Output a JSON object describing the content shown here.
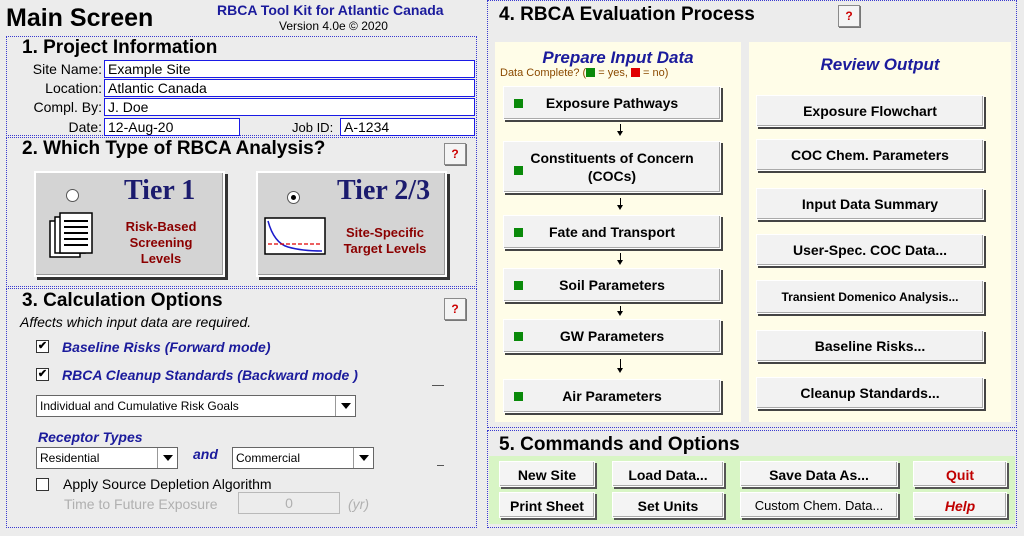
{
  "header": {
    "main_title": "Main Screen",
    "toolkit_title": "RBCA Tool Kit for Atlantic Canada",
    "version": "Version 4.0e  © 2020"
  },
  "project": {
    "title": "1.  Project Information",
    "site_name_label": "Site Name:",
    "site_name": "Example Site",
    "location_label": "Location:",
    "location": "Atlantic Canada",
    "compl_by_label": "Compl. By:",
    "compl_by": "J. Doe",
    "date_label": "Date:",
    "date": "12-Aug-20",
    "job_id_label": "Job ID:",
    "job_id": "A-1234"
  },
  "help_label": "?",
  "analysis": {
    "title": "2.  Which Type of RBCA Analysis?",
    "tier1_title": "Tier 1",
    "tier1_line1": "Risk-Based",
    "tier1_line2": "Screening",
    "tier1_line3": "Levels",
    "tier1_selected": false,
    "tier23_title": "Tier 2/3",
    "tier23_line1": "Site-Specific",
    "tier23_line2": "Target Levels",
    "tier23_selected": true
  },
  "calc": {
    "title": "3.  Calculation Options",
    "subtitle": "Affects which input data are required.",
    "baseline_label": "Baseline Risks (Forward mode)",
    "baseline_checked": true,
    "cleanup_label": "RBCA Cleanup Standards (Backward mode )",
    "cleanup_checked": true,
    "risk_goal_select": "Individual and Cumulative Risk Goals",
    "receptor_title": "Receptor Types",
    "receptor1": "Residential",
    "and_label": "and",
    "receptor2": "Commercial",
    "depletion_label": "Apply Source Depletion Algorithm",
    "depletion_checked": false,
    "time_label": "Time to Future Exposure",
    "time_value": "0",
    "time_unit": "(yr)",
    "check_mark": "✔"
  },
  "evaluation": {
    "title": "4.  RBCA Evaluation Process",
    "prepare_title": "Prepare Input Data",
    "data_complete_prefix": "Data Complete? (",
    "yes_label": " = yes, ",
    "no_label": " = no)",
    "input_buttons": [
      "Exposure Pathways",
      "Constituents of Concern (COCs)",
      "Fate and Transport",
      "Soil Parameters",
      "GW Parameters",
      "Air Parameters"
    ],
    "review_title": "Review Output",
    "output_buttons": [
      "Exposure Flowchart",
      "COC Chem. Parameters",
      "Input Data Summary",
      "User-Spec. COC Data...",
      "Transient Domenico Analysis...",
      "Baseline Risks...",
      "Cleanup Standards..."
    ],
    "complete_color": "#0a8a0a",
    "incomplete_color": "#e00000"
  },
  "commands": {
    "title": "5.  Commands and Options",
    "new_site": "New Site",
    "load_data": "Load Data...",
    "save_data": "Save Data As...",
    "quit": "Quit",
    "print_sheet": "Print Sheet",
    "set_units": "Set Units",
    "custom_chem": "Custom Chem. Data...",
    "help": "Help"
  }
}
